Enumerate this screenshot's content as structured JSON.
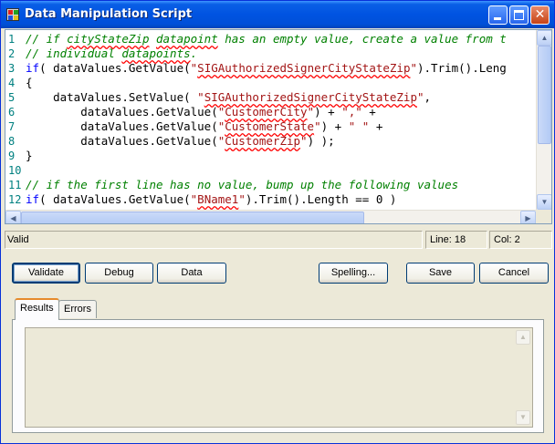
{
  "window": {
    "title": "Data Manipulation Script"
  },
  "editor": {
    "line_numbers": [
      "1",
      "2",
      "3",
      "4",
      "5",
      "6",
      "7",
      "8",
      "9",
      "10",
      "11",
      "12"
    ],
    "lines": [
      [
        {
          "t": "// if ",
          "c": "cmt"
        },
        {
          "t": "cityStateZip",
          "c": "cmt sq"
        },
        {
          "t": " ",
          "c": "cmt"
        },
        {
          "t": "datapoint",
          "c": "cmt sq"
        },
        {
          "t": " has an empty value, create a value from t",
          "c": "cmt"
        }
      ],
      [
        {
          "t": "// individual ",
          "c": "cmt"
        },
        {
          "t": "datapoints",
          "c": "cmt sq"
        },
        {
          "t": ".",
          "c": "cmt"
        }
      ],
      [
        {
          "t": "if",
          "c": "kw"
        },
        {
          "t": "( dataValues.GetValue(",
          "c": ""
        },
        {
          "t": "\"",
          "c": "str"
        },
        {
          "t": "SIGAuthorizedSignerCityStateZip",
          "c": "str sq"
        },
        {
          "t": "\"",
          "c": "str"
        },
        {
          "t": ").Trim().Leng",
          "c": ""
        }
      ],
      [
        {
          "t": "{",
          "c": ""
        }
      ],
      [
        {
          "t": "    dataValues.SetValue( ",
          "c": ""
        },
        {
          "t": "\"",
          "c": "str"
        },
        {
          "t": "SIGAuthorizedSignerCityStateZip",
          "c": "str sq"
        },
        {
          "t": "\"",
          "c": "str"
        },
        {
          "t": ",",
          "c": ""
        }
      ],
      [
        {
          "t": "        dataValues.GetValue(",
          "c": ""
        },
        {
          "t": "\"",
          "c": "str"
        },
        {
          "t": "CustomerCity",
          "c": "str sq"
        },
        {
          "t": "\"",
          "c": "str"
        },
        {
          "t": ") + ",
          "c": ""
        },
        {
          "t": "\",\"",
          "c": "str"
        },
        {
          "t": " +",
          "c": ""
        }
      ],
      [
        {
          "t": "        dataValues.GetValue(",
          "c": ""
        },
        {
          "t": "\"",
          "c": "str"
        },
        {
          "t": "CustomerState",
          "c": "str sq"
        },
        {
          "t": "\"",
          "c": "str"
        },
        {
          "t": ") + ",
          "c": ""
        },
        {
          "t": "\" \"",
          "c": "str"
        },
        {
          "t": " +",
          "c": ""
        }
      ],
      [
        {
          "t": "        dataValues.GetValue(",
          "c": ""
        },
        {
          "t": "\"",
          "c": "str"
        },
        {
          "t": "CustomerZip",
          "c": "str sq"
        },
        {
          "t": "\"",
          "c": "str"
        },
        {
          "t": ") );",
          "c": ""
        }
      ],
      [
        {
          "t": "}",
          "c": ""
        }
      ],
      [
        {
          "t": "",
          "c": ""
        }
      ],
      [
        {
          "t": "// if the first line has no value, bump up the following values",
          "c": "cmt"
        }
      ],
      [
        {
          "t": "if",
          "c": "kw"
        },
        {
          "t": "( dataValues.GetValue(",
          "c": ""
        },
        {
          "t": "\"",
          "c": "str"
        },
        {
          "t": "BName1",
          "c": "str sq"
        },
        {
          "t": "\"",
          "c": "str"
        },
        {
          "t": ").Trim().Length == 0 )",
          "c": ""
        }
      ]
    ]
  },
  "status": {
    "message": "Valid",
    "line": "Line: 18",
    "col": "Col: 2"
  },
  "buttons": {
    "validate": "Validate",
    "debug": "Debug",
    "data": "Data",
    "spelling": "Spelling...",
    "save": "Save",
    "cancel": "Cancel"
  },
  "tabs": {
    "results": "Results",
    "errors": "Errors"
  },
  "icons": {
    "app": "app-icon",
    "minimize": "minimize-icon",
    "maximize": "maximize-icon",
    "close": "close-icon",
    "scroll_up": "arrow-up-icon",
    "scroll_down": "arrow-down-icon",
    "scroll_left": "arrow-left-icon",
    "scroll_right": "arrow-right-icon"
  },
  "colors": {
    "titlebar": "#0053e1",
    "comment": "#008000",
    "keyword": "#0000ff",
    "string": "#a31515",
    "line_number": "#008080",
    "tab_accent": "#e68b2c"
  }
}
